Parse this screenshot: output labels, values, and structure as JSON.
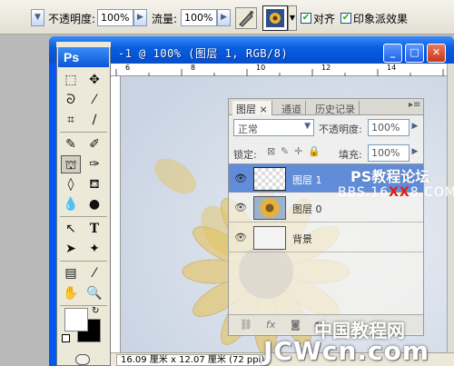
{
  "options_bar": {
    "opacity_label": "不透明度:",
    "opacity_value": "100%",
    "flow_label": "流量:",
    "flow_value": "100%",
    "align_label": "对齐",
    "align_checked": true,
    "impressionist_label": "印象派效果",
    "impressionist_checked": true
  },
  "document": {
    "title": "-1 @ 100% (图层 1, RGB/8)",
    "ruler_marks": [
      "6",
      "8",
      "10",
      "12",
      "14"
    ],
    "status": "16.09 厘米 x 12.07 厘米 (72 ppi)"
  },
  "toolbox": {
    "header": "Ps",
    "tools": [
      [
        "marquee-icon",
        "move-icon"
      ],
      [
        "lasso-icon",
        "magic-wand-icon"
      ],
      [
        "crop-icon",
        "slice-icon"
      ],
      [
        "healing-brush-icon",
        "brush-icon"
      ],
      [
        "clone-stamp-icon",
        "history-brush-icon"
      ],
      [
        "eraser-icon",
        "paint-bucket-icon"
      ],
      [
        "blur-icon",
        "dodge-icon"
      ],
      [
        "path-selection-icon",
        "type-icon"
      ],
      [
        "direct-selection-icon",
        "shape-icon"
      ],
      [
        "notes-icon",
        "eyedropper-icon"
      ],
      [
        "hand-icon",
        "zoom-icon"
      ]
    ]
  },
  "layers_panel": {
    "tabs": [
      "图层",
      "通道",
      "历史记录"
    ],
    "blend_mode": "正常",
    "opacity_label": "不透明度:",
    "opacity_value": "100%",
    "lock_label": "锁定:",
    "fill_label": "填充:",
    "fill_value": "100%",
    "layers": [
      {
        "name": "图层 1",
        "selected": true
      },
      {
        "name": "图层 0",
        "selected": false
      },
      {
        "name": "背景",
        "selected": false
      }
    ]
  },
  "watermarks": {
    "ps_forum": "PS教程论坛",
    "bbs_prefix": "BBS.16",
    "bbs_xx": "XX",
    "bbs_suffix": "8.COM",
    "site_cn": "中国教程网",
    "site_en": "JCWcn.com"
  }
}
